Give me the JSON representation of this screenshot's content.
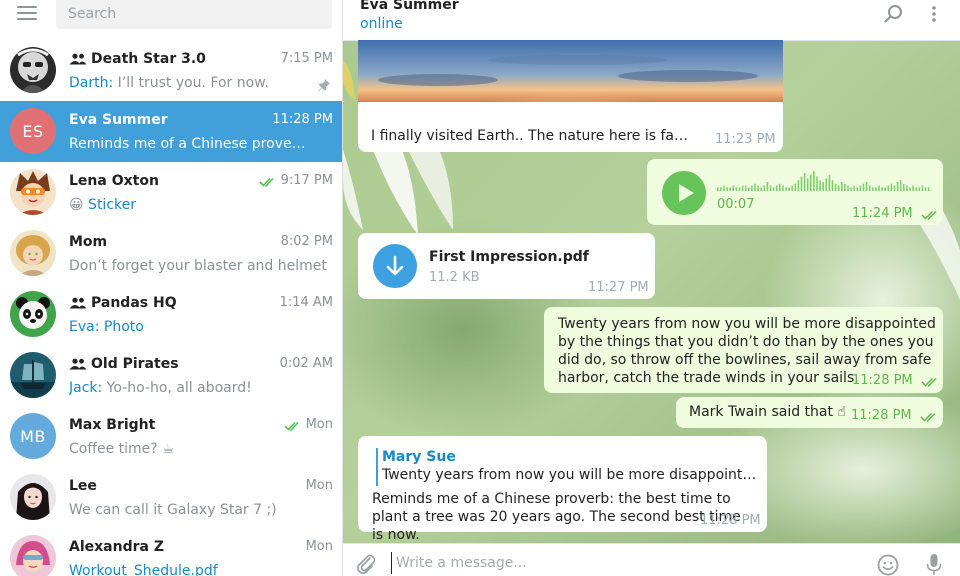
{
  "app": {
    "search_placeholder": "Search",
    "accent": "#419fd9",
    "link_color": "#168acd",
    "outgoing_bubble_color": "#effdde",
    "incoming_bubble_color": "#ffffff"
  },
  "chats": [
    {
      "name": "Death Star 3.0",
      "is_group": true,
      "time": "7:15 PM",
      "sender": "Darth:",
      "preview": " I’ll trust you. For now.",
      "pinned": true,
      "avatar_icon": "stormtrooper-avatar"
    },
    {
      "name": "Eva Summer",
      "initials": "ES",
      "avatar_color": "#e17076",
      "time": "11:28 PM",
      "preview": "Reminds me of a Chinese prove…",
      "selected": true
    },
    {
      "name": "Lena Oxton",
      "time": "9:17 PM",
      "read": true,
      "emoji": "😀",
      "preview_link": " Sticker",
      "avatar_icon": "tracer-avatar"
    },
    {
      "name": "Mom",
      "time": "8:02 PM",
      "preview": "Don’t forget your blaster and helmet",
      "avatar_icon": "mom-avatar"
    },
    {
      "name": "Pandas HQ",
      "is_group": true,
      "time": "1:14 AM",
      "sender": "Eva:",
      "preview_link": " Photo",
      "avatar_icon": "panda-avatar"
    },
    {
      "name": "Old Pirates",
      "is_group": true,
      "time": "0:02 AM",
      "sender": "Jack:",
      "preview": " Yo-ho-ho, all aboard!",
      "avatar_icon": "pirate-ship-avatar"
    },
    {
      "name": "Max Bright",
      "initials": "MB",
      "avatar_color": "#65aadd",
      "time": "Mon",
      "read": true,
      "preview": "Coffee time? ☕"
    },
    {
      "name": "Lee",
      "time": "Mon",
      "preview": "We can call it Galaxy Star 7 ;)",
      "avatar_icon": "lee-avatar"
    },
    {
      "name": "Alexandra Z",
      "time": "Mon",
      "preview_link": "Workout_Shedule.pdf",
      "avatar_icon": "alexandra-avatar"
    }
  ],
  "conversation": {
    "name": "Eva Summer",
    "status": "online",
    "messages": [
      {
        "id": "photo",
        "text": "I finally visited Earth.. The nature here is fantastic!",
        "time": "11:23 PM"
      },
      {
        "id": "voice",
        "duration": "00:07",
        "time": "11:24 PM",
        "read": true
      },
      {
        "id": "file",
        "file_name": "First Impression.pdf",
        "file_size": "11.2 KB",
        "time": "11:27 PM"
      },
      {
        "id": "quote",
        "text": "Twenty years from now you will be more disappointed by the things that you didn’t do than by the ones you did do, so throw off the bowlines, sail away from safe harbor, catch the trade winds in your sails.",
        "time": "11:28 PM",
        "read": true
      },
      {
        "id": "twain",
        "text": "Mark Twain said that ☝",
        "time": "11:28 PM",
        "read": true
      },
      {
        "id": "reply",
        "reply_author": "Mary Sue",
        "reply_text": "Twenty years from now you will be more disappointed by t…",
        "text": "Reminds me of a Chinese proverb: the best time to plant a tree was 20 years ago. The second best time is now.",
        "time": "11:28 PM"
      }
    ]
  },
  "composer": {
    "placeholder": "Write a message..."
  }
}
